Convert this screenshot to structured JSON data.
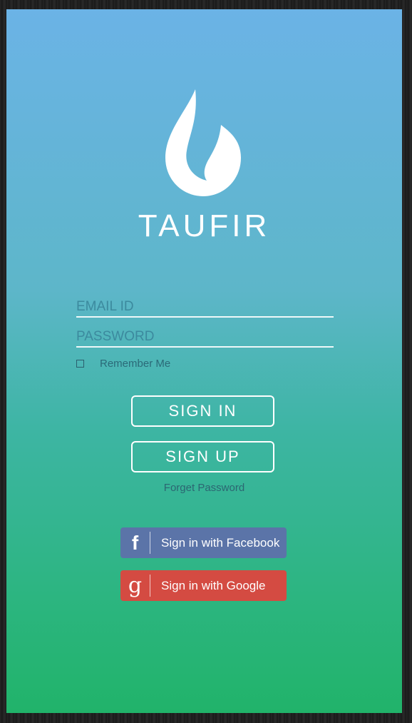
{
  "app": {
    "brand_name": "TAUFIR"
  },
  "form": {
    "email_placeholder": "EMAIL ID",
    "password_placeholder": "PASSWORD",
    "remember_label": "Remember Me",
    "remember_checked": false
  },
  "buttons": {
    "sign_in": "SIGN IN",
    "sign_up": "SIGN UP",
    "forgot": "Forget Password"
  },
  "social": {
    "facebook_label": "Sign in with Facebook",
    "facebook_icon": "f",
    "google_label": "Sign in with Google",
    "google_icon": "g"
  },
  "colors": {
    "gradient_top": "#6bb3e6",
    "gradient_bottom": "#21b36a",
    "facebook": "#5b74a8",
    "google": "#d44b42"
  }
}
